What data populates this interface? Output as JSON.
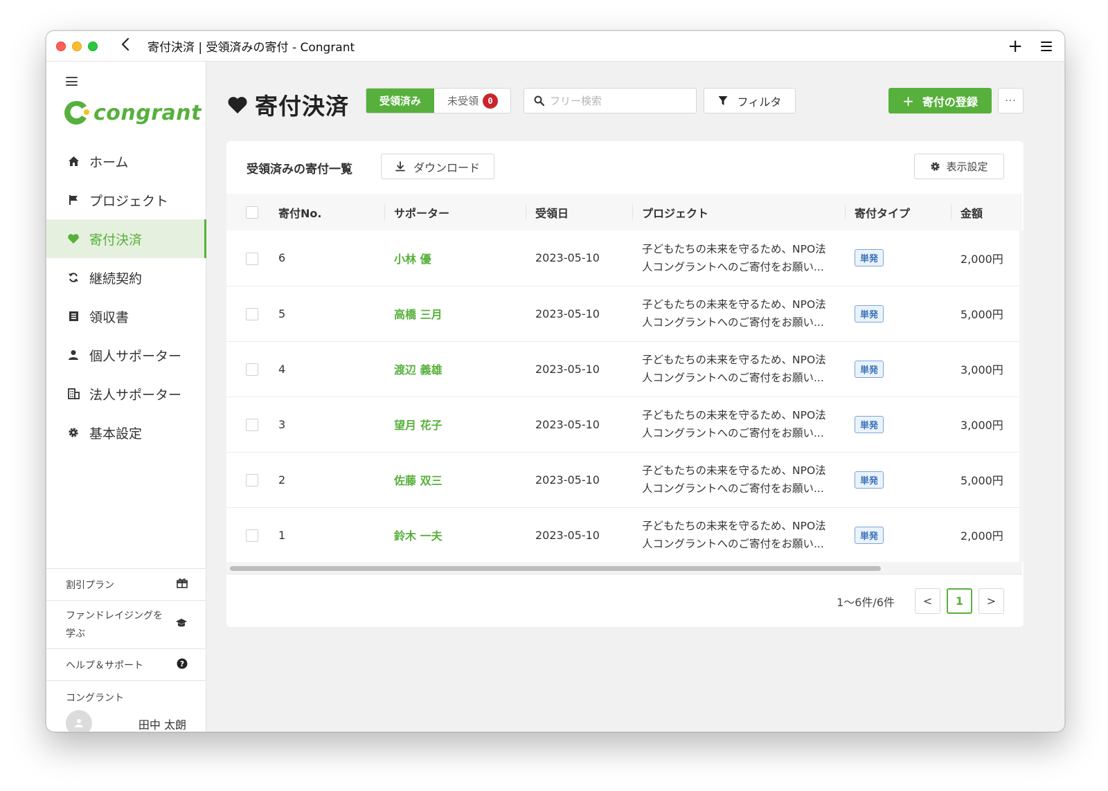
{
  "window": {
    "title": "寄付決済 | 受領済みの寄付 - Congrant"
  },
  "brand": {
    "logo_text": "congrant",
    "accent": "#57b03c"
  },
  "sidebar": {
    "items": [
      {
        "label": "ホーム",
        "icon": "home-icon"
      },
      {
        "label": "プロジェクト",
        "icon": "flag-icon"
      },
      {
        "label": "寄付決済",
        "icon": "heart-icon",
        "active": true
      },
      {
        "label": "継続契約",
        "icon": "refresh-icon"
      },
      {
        "label": "領収書",
        "icon": "receipt-icon"
      },
      {
        "label": "個人サポーター",
        "icon": "person-icon"
      },
      {
        "label": "法人サポーター",
        "icon": "building-icon"
      },
      {
        "label": "基本設定",
        "icon": "gear-icon"
      }
    ],
    "bottom": {
      "discount_plan": "割引プラン",
      "learn_line1": "ファンドレイジングを",
      "learn_line2": "学ぶ",
      "help": "ヘルプ＆サポート",
      "org_name": "コングラント",
      "user_name": "田中 太朗"
    }
  },
  "header": {
    "title": "寄付決済",
    "tab_received": "受領済み",
    "tab_unreceived": "未受領",
    "unreceived_count": "0",
    "search_placeholder": "フリー検索",
    "filter_label": "フィルタ",
    "register_label": "寄付の登録",
    "more_label": "···"
  },
  "list": {
    "title": "受領済みの寄付一覧",
    "download_label": "ダウンロード",
    "display_settings_label": "表示設定",
    "columns": [
      "寄付No.",
      "サポーター",
      "受領日",
      "プロジェクト",
      "寄付タイプ",
      "金額"
    ],
    "rows": [
      {
        "no": "6",
        "supporter": "小林 優",
        "date": "2023-05-10",
        "project_line1": "子どもたちの未来を守るため、NPO法",
        "project_line2": "人コングラントへのご寄付をお願い...",
        "type": "単発",
        "amount": "2,000円"
      },
      {
        "no": "5",
        "supporter": "高橋 三月",
        "date": "2023-05-10",
        "project_line1": "子どもたちの未来を守るため、NPO法",
        "project_line2": "人コングラントへのご寄付をお願い...",
        "type": "単発",
        "amount": "5,000円"
      },
      {
        "no": "4",
        "supporter": "渡辺 義雄",
        "date": "2023-05-10",
        "project_line1": "子どもたちの未来を守るため、NPO法",
        "project_line2": "人コングラントへのご寄付をお願い...",
        "type": "単発",
        "amount": "3,000円"
      },
      {
        "no": "3",
        "supporter": "望月 花子",
        "date": "2023-05-10",
        "project_line1": "子どもたちの未来を守るため、NPO法",
        "project_line2": "人コングラントへのご寄付をお願い...",
        "type": "単発",
        "amount": "3,000円"
      },
      {
        "no": "2",
        "supporter": "佐藤 双三",
        "date": "2023-05-10",
        "project_line1": "子どもたちの未来を守るため、NPO法",
        "project_line2": "人コングラントへのご寄付をお願い...",
        "type": "単発",
        "amount": "5,000円"
      },
      {
        "no": "1",
        "supporter": "鈴木 一夫",
        "date": "2023-05-10",
        "project_line1": "子どもたちの未来を守るため、NPO法",
        "project_line2": "人コングラントへのご寄付をお願い...",
        "type": "単発",
        "amount": "2,000円"
      }
    ]
  },
  "pagination": {
    "info": "1〜6件/6件",
    "current_page": "1",
    "prev": "<",
    "next": ">"
  }
}
